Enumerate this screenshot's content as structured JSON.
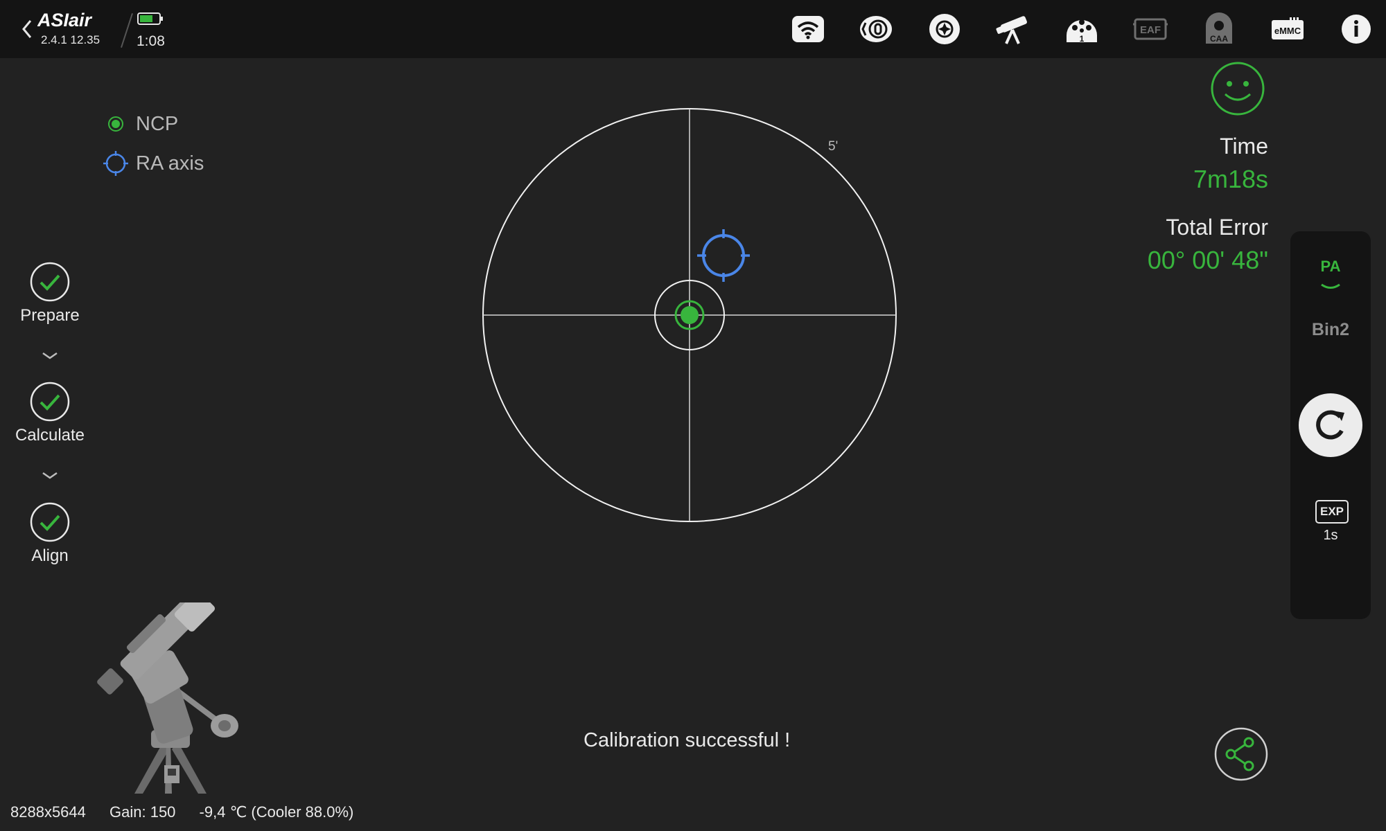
{
  "header": {
    "logo_text": "ASIair",
    "version": "2.4.1 12.35",
    "clock": "1:08",
    "battery_level": 0.7,
    "icons": [
      "wifi-icon",
      "camera-shutter-icon",
      "guide-target-icon",
      "telescope-icon",
      "filter-wheel-icon",
      "eaf-icon",
      "caa-icon",
      "emmc-icon",
      "info-icon"
    ],
    "filter_wheel_slot": "1",
    "eaf_text": "EAF",
    "caa_text": "CAA",
    "emmc_text": "eMMC"
  },
  "legend": {
    "ncp_label": "NCP",
    "ra_axis_label": "RA axis"
  },
  "steps": {
    "prepare": "Prepare",
    "calculate": "Calculate",
    "align": "Align"
  },
  "target": {
    "ring_label": "5'"
  },
  "info": {
    "time_label": "Time",
    "time_value": "7m18s",
    "error_label": "Total Error",
    "error_value": "00° 00' 48\""
  },
  "message": "Calibration successful !",
  "side_panel": {
    "mode": "PA",
    "bin": "Bin2",
    "exp_label": "EXP",
    "exp_value": "1s"
  },
  "status_bar": {
    "resolution": "8288x5644",
    "gain": "Gain: 150",
    "temperature": "-9,4 ℃ (Cooler 88.0%)"
  },
  "colors": {
    "background": "#222222",
    "topbar": "#141414",
    "accent_green": "#38b53d",
    "ra_blue": "#4a86e8"
  }
}
